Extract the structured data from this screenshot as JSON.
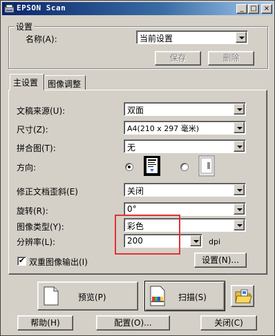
{
  "window": {
    "title": "EPSON Scan"
  },
  "titlebar_buttons": {
    "minimize": "_",
    "maximize": "□",
    "close": "×"
  },
  "settings_group": {
    "legend": "设置",
    "name_label": "名称(A):",
    "name_value": "当前设置",
    "save_label": "保存",
    "delete_label": "删除"
  },
  "tabs": [
    {
      "label": "主设置",
      "active": true
    },
    {
      "label": "图像调整",
      "active": false
    }
  ],
  "main": {
    "source": {
      "label": "文稿来源(U):",
      "value": "双面"
    },
    "size": {
      "label": "尺寸(Z):",
      "value": "A4(210 x 297 毫米)"
    },
    "stitch": {
      "label": "拼合图(T):",
      "value": "无"
    },
    "orientation": {
      "label": "方向:",
      "selected": "portrait"
    },
    "skew": {
      "label": "修正文档歪斜(E)",
      "value": "关闭"
    },
    "rotate": {
      "label": "旋转(R):",
      "value": "0°"
    },
    "image_type": {
      "label": "图像类型(Y):",
      "value": "彩色"
    },
    "resolution": {
      "label": "分辨率(L):",
      "value": "200",
      "unit": "dpi"
    },
    "double_output": {
      "label": "双重图像输出(I)",
      "checked": true,
      "check_mark": "✔"
    },
    "config_button": "设置(N)..."
  },
  "actions": {
    "preview": "预览(P)",
    "scan": "扫描(S)"
  },
  "footer": {
    "help": "帮助(H)",
    "configure": "配置(O)...",
    "close": "关闭(C)"
  },
  "colors": {
    "highlight": "#e53030",
    "titlebar_start": "#0a246a",
    "titlebar_end": "#a6caf0"
  }
}
